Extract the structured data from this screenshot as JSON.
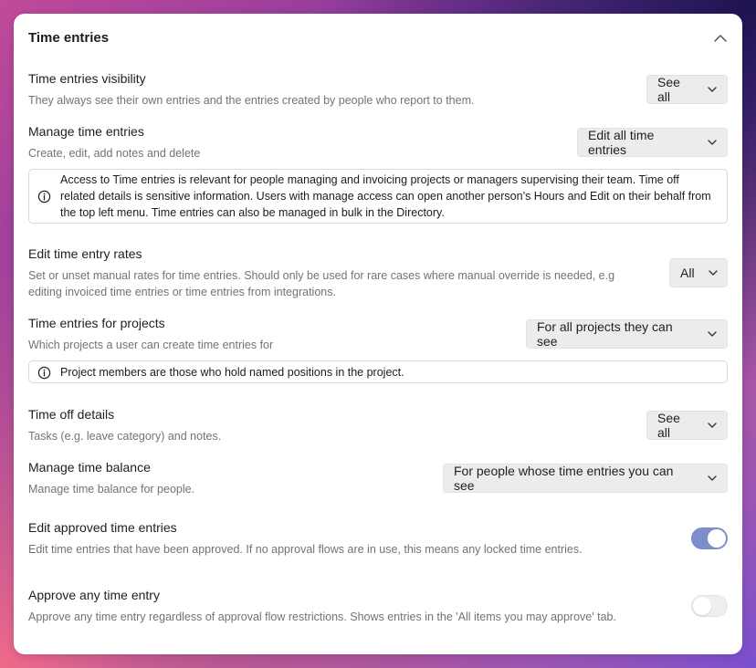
{
  "section": {
    "title": "Time entries"
  },
  "rows": {
    "visibility": {
      "title": "Time entries visibility",
      "desc": "They always see their own entries and the entries created by people who report to them.",
      "value": "See all"
    },
    "manage": {
      "title": "Manage time entries",
      "desc": "Create, edit, add notes and delete",
      "value": "Edit all time entries",
      "info": "Access to Time entries is relevant for people managing and invoicing projects or managers supervising their team. Time off related details is sensitive information. Users with manage access can open another person’s Hours and Edit on their behalf from the top left menu. Time entries can also be managed in bulk in the Directory."
    },
    "rates": {
      "title": "Edit time entry rates",
      "desc": "Set or unset manual rates for time entries. Should only be used for rare cases where manual override is needed, e.g editing invoiced time entries or time entries from integrations.",
      "value": "All"
    },
    "projects": {
      "title": "Time entries for projects",
      "desc": "Which projects a user can create time entries for",
      "value": "For all projects they can see",
      "info": "Project members are those who hold named positions in the project."
    },
    "timeoff": {
      "title": "Time off details",
      "desc": "Tasks (e.g. leave category) and notes.",
      "value": "See all"
    },
    "balance": {
      "title": "Manage time balance",
      "desc": "Manage time balance for people.",
      "value": "For people whose time entries you can see"
    },
    "approved": {
      "title": "Edit approved time entries",
      "desc": "Edit time entries that have been approved. If no approval flows are in use, this means any locked time entries.",
      "enabled": true
    },
    "approve": {
      "title": "Approve any time entry",
      "desc": "Approve any time entry regardless of approval flow restrictions. Shows entries in the 'All items you may approve' tab.",
      "enabled": false
    }
  },
  "colors": {
    "toggle_on": "#7c8fcc",
    "toggle_off": "#efeff2",
    "select_bg": "#ececef"
  },
  "icons": {
    "collapse": "chevron-up-icon",
    "dropdown": "chevron-down-icon",
    "info": "info-icon"
  }
}
